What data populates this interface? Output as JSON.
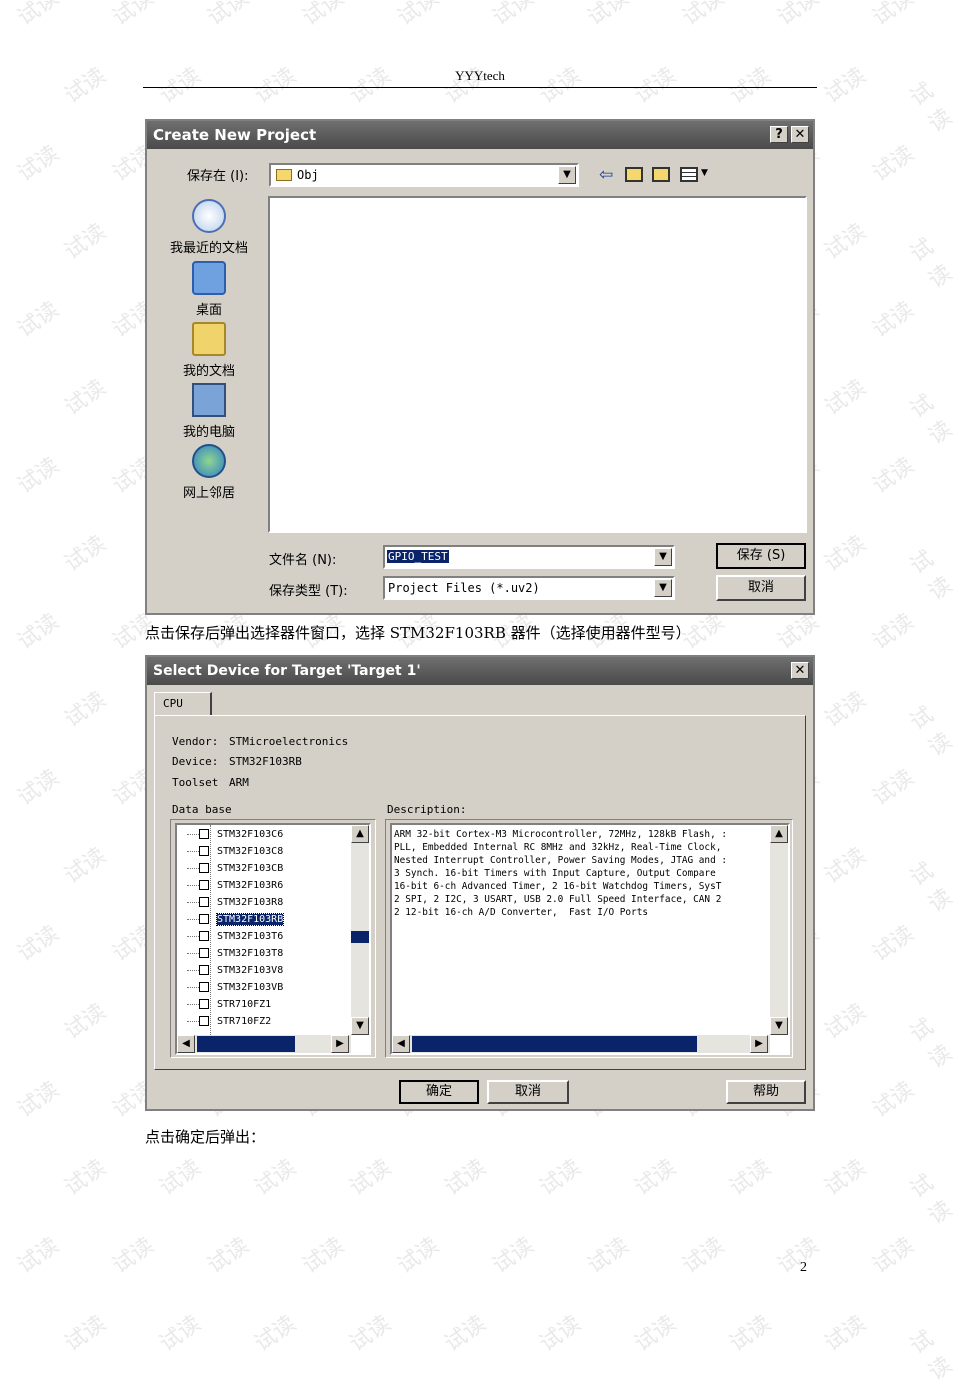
{
  "header": {
    "title": "YYYtech"
  },
  "watermark": {
    "text": "试读"
  },
  "dialog1": {
    "title": "Create New Project",
    "help_btn": "?",
    "close_btn": "✕",
    "save_in_label": "保存在 (I):",
    "save_in_value": "Obj",
    "places": [
      "我最近的文档",
      "桌面",
      "我的文档",
      "我的电脑",
      "网上邻居"
    ],
    "filename_label": "文件名 (N):",
    "filename_value": "GPIO_TEST",
    "filetype_label": "保存类型 (T):",
    "filetype_value": "Project Files (*.uv2)",
    "save_button": "保存 (S)",
    "cancel_button": "取消"
  },
  "caption1": "点击保存后弹出选择器件窗口，选择 STM32F103RB 器件（选择使用器件型号）",
  "dialog2": {
    "title": "Select Device for Target 'Target 1'",
    "close_btn": "✕",
    "tab": "CPU",
    "vendor_label": "Vendor:",
    "vendor_value": "STMicroelectronics",
    "device_label": "Device:",
    "device_value": "STM32F103RB",
    "toolset_label": "Toolset",
    "toolset_value": "ARM",
    "database_label": "Data base",
    "description_label": "Description:",
    "devices": [
      "STM32F103C6",
      "STM32F103C8",
      "STM32F103CB",
      "STM32F103R6",
      "STM32F103R8",
      "STM32F103RB",
      "STM32F103T6",
      "STM32F103T8",
      "STM32F103V8",
      "STM32F103VB",
      "STR710FZ1",
      "STR710FZ2"
    ],
    "selected_device": "STM32F103RB",
    "description_lines": [
      "ARM 32-bit Cortex-M3 Microcontroller, 72MHz, 128kB Flash, :",
      "PLL, Embedded Internal RC 8MHz and 32kHz, Real-Time Clock,",
      "Nested Interrupt Controller, Power Saving Modes, JTAG and :",
      "3 Synch. 16-bit Timers with Input Capture, Output Compare",
      "16-bit 6-ch Advanced Timer, 2 16-bit Watchdog Timers, SysT",
      "2 SPI, 2 I2C, 3 USART, USB 2.0 Full Speed Interface, CAN 2",
      "2 12-bit 16-ch A/D Converter,  Fast I/O Ports"
    ],
    "ok_button": "确定",
    "cancel_button": "取消",
    "help_button": "帮助"
  },
  "caption2": "点击确定后弹出：",
  "page_number": "2"
}
